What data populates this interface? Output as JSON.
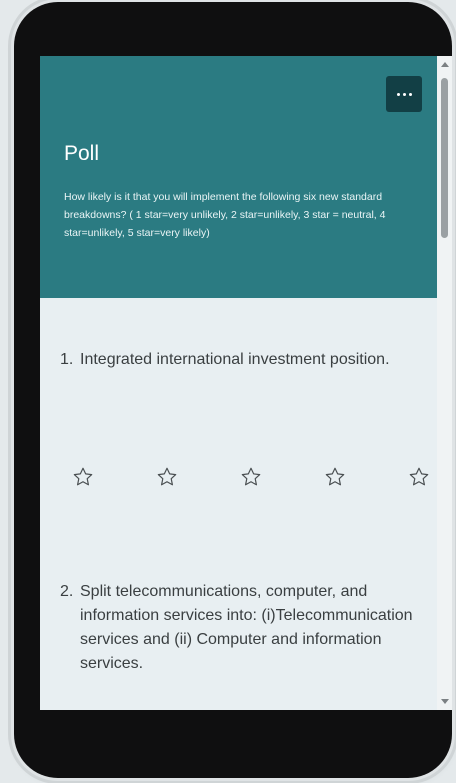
{
  "poll": {
    "title": "Poll",
    "question": "How likely is it that you will implement the following six new standard breakdowns? ( 1 star=very unlikely, 2 star=unlikely, 3 star = neutral, 4 star=unlikely, 5 star=very likely)"
  },
  "menu_button": {
    "icon": "ellipsis-icon"
  },
  "items": [
    {
      "number": "1.",
      "text": "Integrated international investment position."
    },
    {
      "number": "2.",
      "text": "Split telecommunications, computer, and information services into: (i)Telecommunication services and (ii) Computer and information services."
    }
  ],
  "rating": {
    "max_stars": 5,
    "selected": 0,
    "star_icon": "star-outline-icon"
  },
  "colors": {
    "header": "#2b7b82",
    "menu_button": "#123f45",
    "content_bg": "#e8eff2"
  }
}
